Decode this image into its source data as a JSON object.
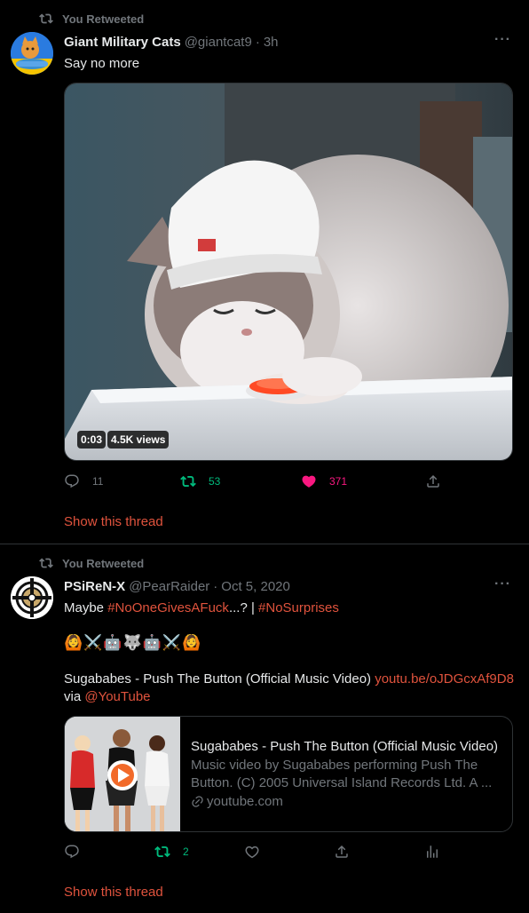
{
  "tweets": [
    {
      "retweet_label": "You Retweeted",
      "author_name": "Giant Military Cats",
      "author_handle": "@giantcat9",
      "separator": "·",
      "time": "3h",
      "text": "Say no more",
      "video": {
        "duration": "0:03",
        "views": "4.5K views"
      },
      "actions": {
        "replies": "11",
        "retweets": "53",
        "likes": "371"
      },
      "show_thread": "Show this thread"
    },
    {
      "retweet_label": "You Retweeted",
      "author_name": "PSiReN-X",
      "author_handle": "@PearRaider",
      "separator": "·",
      "time": "Oct 5, 2020",
      "text_prefix": "Maybe ",
      "hashtag1": "#NoOneGivesAFuck",
      "text_mid": "...? | ",
      "hashtag2": "#NoSurprises",
      "emoji_line": "🙆⚔️🤖🐺🤖⚔️🙆",
      "link_text": "Sugababes - Push The Button (Official Music Video) ",
      "link_url": "youtu.be/oJDGcxAf9D8",
      "via": "via ",
      "via_handle": "@YouTube",
      "card": {
        "title": "Sugababes - Push The Button (Official Music Video)",
        "description": "Music video by Sugababes performing Push The Button. (C) 2005 Universal Island Records Ltd. A ...",
        "domain": "youtube.com"
      },
      "actions": {
        "retweets": "2"
      },
      "show_thread": "Show this thread"
    }
  ],
  "colors": {
    "accent": "#e0533d",
    "retweet_green": "#00ba7c",
    "like_pink": "#f91880",
    "muted": "#71767b"
  },
  "icons": [
    "retweet-icon",
    "more-icon",
    "reply-icon",
    "like-icon",
    "share-icon",
    "analytics-icon",
    "play-icon",
    "link-icon"
  ]
}
